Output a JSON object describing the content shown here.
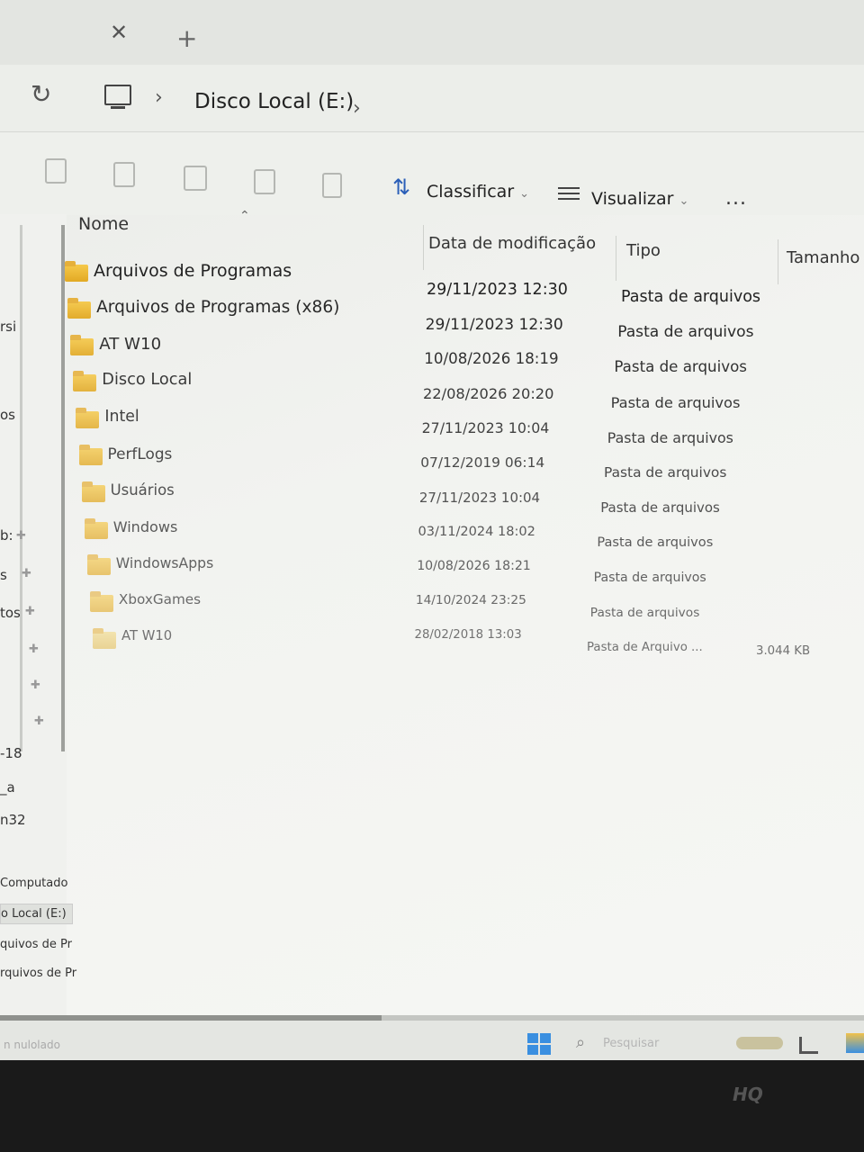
{
  "window": {
    "breadcrumb": "Disco Local (E:)"
  },
  "toolbar": {
    "sort_label": "Classificar",
    "view_label": "Visualizar",
    "more_label": "..."
  },
  "columns": {
    "name": "Nome",
    "date": "Data de modificação",
    "type": "Tipo",
    "size": "Tamanho"
  },
  "files": [
    {
      "name": "Arquivos de Programas",
      "date": "29/11/2023 12:30",
      "type": "Pasta de arquivos",
      "size": "",
      "kind": "folder"
    },
    {
      "name": "Arquivos de Programas (x86)",
      "date": "29/11/2023 12:30",
      "type": "Pasta de arquivos",
      "size": "",
      "kind": "folder"
    },
    {
      "name": "AT W10",
      "date": "10/08/2026 18:19",
      "type": "Pasta de arquivos",
      "size": "",
      "kind": "folder"
    },
    {
      "name": "Disco Local",
      "date": "22/08/2026 20:20",
      "type": "Pasta de arquivos",
      "size": "",
      "kind": "folder"
    },
    {
      "name": "Intel",
      "date": "27/11/2023 10:04",
      "type": "Pasta de arquivos",
      "size": "",
      "kind": "folder"
    },
    {
      "name": "PerfLogs",
      "date": "07/12/2019 06:14",
      "type": "Pasta de arquivos",
      "size": "",
      "kind": "folder"
    },
    {
      "name": "Usuários",
      "date": "27/11/2023 10:04",
      "type": "Pasta de arquivos",
      "size": "",
      "kind": "folder"
    },
    {
      "name": "Windows",
      "date": "03/11/2024 18:02",
      "type": "Pasta de arquivos",
      "size": "",
      "kind": "folder"
    },
    {
      "name": "WindowsApps",
      "date": "10/08/2026 18:21",
      "type": "Pasta de arquivos",
      "size": "",
      "kind": "folder"
    },
    {
      "name": "XboxGames",
      "date": "14/10/2024 23:25",
      "type": "Pasta de arquivos",
      "size": "",
      "kind": "folder"
    },
    {
      "name": "AT W10",
      "date": "28/02/2018 13:03",
      "type": "Pasta de Arquivo ...",
      "size": "3.044 KB",
      "kind": "archive"
    }
  ],
  "sidebar": {
    "items": [
      "rsi",
      "os",
      "b:",
      "s",
      "tos",
      "-18",
      "_a",
      "n32",
      "Computado",
      "o Local (E:)",
      "quivos de Pr",
      "rquivos de Pr"
    ]
  },
  "taskbar": {
    "status": "n nulolado",
    "search_placeholder": "Pesquisar"
  },
  "bezel": {
    "brand": "HQ"
  },
  "colors": {
    "folder": "#f2c14e",
    "accent": "#2b5fb8"
  }
}
